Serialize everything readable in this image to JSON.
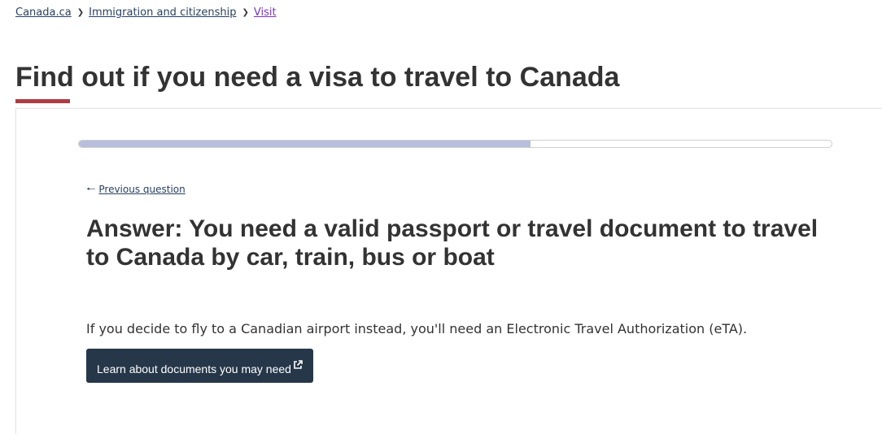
{
  "breadcrumb": {
    "items": [
      {
        "label": "Canada.ca"
      },
      {
        "label": "Immigration and citizenship"
      },
      {
        "label": "Visit"
      }
    ],
    "separator_icon": "chevron-right-icon"
  },
  "page": {
    "title": "Find out if you need a visa to travel to Canada"
  },
  "wizard": {
    "progress_percent": 60,
    "previous_label": "Previous question",
    "previous_icon": "arrow-left-icon",
    "answer_heading": "Answer: You need a valid passport or travel document to travel to Canada by car, train, bus or boat",
    "info_text": "If you decide to fly to a Canadian airport instead, you'll need an Electronic Travel Authorization (eTA).",
    "learn_button_label": "Learn about documents you may need",
    "learn_button_icon": "external-link-icon"
  },
  "colors": {
    "accent_underline": "#af3c43",
    "link": "#284162",
    "visited_link": "#7834bc",
    "button_bg": "#26374a",
    "progress_fill": "#b8bfdc"
  }
}
